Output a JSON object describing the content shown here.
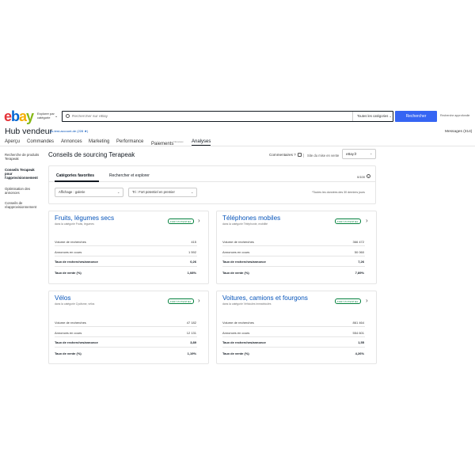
{
  "header": {
    "logo": {
      "e": "e",
      "b": "b",
      "a": "a",
      "y": "y"
    },
    "explore_label": "Explorer par catégorie",
    "search": {
      "placeholder": "Rechercher sur eBay"
    },
    "category_select": "Toutes les catégories",
    "search_button": "Rechercher",
    "advanced_link": "Recherche approfondie"
  },
  "hub": {
    "title": "Hub vendeur",
    "account": "ps-test-account-de (228 ★)",
    "messages": "Messages (314)"
  },
  "nav": {
    "items": [
      "Aperçu",
      "Commandes",
      "Annonces",
      "Marketing",
      "Performance",
      "Paiements",
      "Analyses"
    ],
    "paiements_sup": "Nouveau"
  },
  "sidebar": {
    "items": [
      "Recherche de produits Terapeak",
      "Conseils Terapeak pour l'approvisionnement",
      "Optimisation des annonces",
      "Conseils de réapprovisionnement"
    ]
  },
  "main": {
    "title": "Conseils de sourcing Terapeak",
    "comments": "Commentaires ?",
    "site_label": "Site du mise en vente",
    "site_value": "eBay.fr",
    "tabs": [
      "Catégories favorites",
      "Rechercher et explorer"
    ],
    "count": "0/100",
    "display_filter": "Affichage : galerie",
    "sort_filter": "Tri : Fort potentiel en premier",
    "note": "*Toutes les données des 30 derniers jours"
  },
  "cards": [
    {
      "title": "Fruits, légumes secs",
      "subtitle": "dans la catégorie Fruits, légumes",
      "badge": "FORT POTENTIEL",
      "rows": [
        {
          "label": "Volume de recherches",
          "value": "415"
        },
        {
          "label": "Annonces en cours",
          "value": "1 592"
        },
        {
          "label": "Taux de recherches/annonce",
          "value": "0,26"
        },
        {
          "label": "Taux de vente (%)",
          "value": "1,08%"
        }
      ]
    },
    {
      "title": "Téléphones mobiles",
      "subtitle": "dans la catégorie Téléphonie, mobilité",
      "badge": "FORT POTENTIEL",
      "rows": [
        {
          "label": "Volume de recherches",
          "value": "366 472"
        },
        {
          "label": "Annonces en cours",
          "value": "50 060"
        },
        {
          "label": "Taux de recherches/annonce",
          "value": "7,26"
        },
        {
          "label": "Taux de vente (%)",
          "value": "7,89%"
        }
      ]
    },
    {
      "title": "Vélos",
      "subtitle": "dans la catégorie Cyclisme, vélos",
      "badge": "FORT POTENTIEL",
      "rows": [
        {
          "label": "Volume de recherches",
          "value": "47 182"
        },
        {
          "label": "Annonces en cours",
          "value": "12 131"
        },
        {
          "label": "Taux de recherches/annonce",
          "value": "3,89"
        },
        {
          "label": "Taux de vente (%)",
          "value": "1,19%"
        }
      ]
    },
    {
      "title": "Voitures, camions et fourgons",
      "subtitle": "dans la catégorie Véhicules immatriculés",
      "badge": "FORT POTENTIEL",
      "rows": [
        {
          "label": "Volume de recherches",
          "value": "861 464"
        },
        {
          "label": "Annonces en cours",
          "value": "554 601"
        },
        {
          "label": "Taux de recherches/annonce",
          "value": "1,55"
        },
        {
          "label": "Taux de vente (%)",
          "value": "4,26%"
        }
      ]
    }
  ]
}
